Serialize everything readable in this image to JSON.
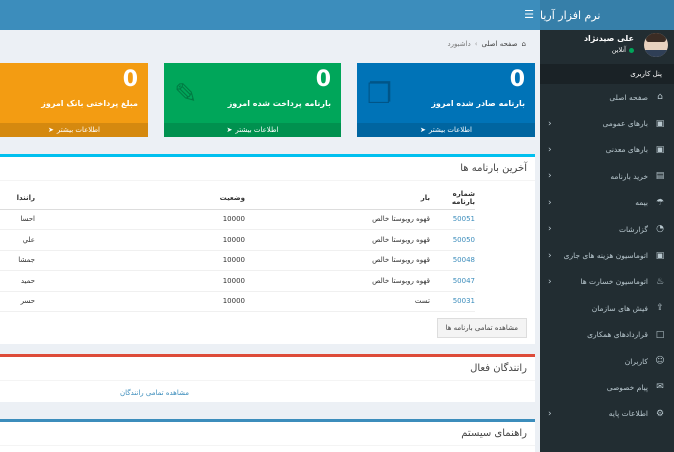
{
  "app": {
    "title": "نرم افزار آریا"
  },
  "user": {
    "name": "علی صیدنژاد",
    "status": "آنلاین"
  },
  "sidebar": {
    "header": "پنل کاربری",
    "items": [
      {
        "label": "صفحه اصلی",
        "icon": "home-icon",
        "has_children": false
      },
      {
        "label": "بارهای عمومی",
        "icon": "truck-icon",
        "has_children": true
      },
      {
        "label": "بارهای معدنی",
        "icon": "truck-icon",
        "has_children": true
      },
      {
        "label": "خرید بارنامه",
        "icon": "cart-icon",
        "has_children": true
      },
      {
        "label": "بیمه",
        "icon": "umbrella-icon",
        "has_children": true
      },
      {
        "label": "گزارشات",
        "icon": "pie-chart-icon",
        "has_children": true
      },
      {
        "label": "اتوماسیون هزینه های جاری",
        "icon": "truck-icon",
        "has_children": true
      },
      {
        "label": "اتوماسیون خسارت ها",
        "icon": "fire-icon",
        "has_children": true
      },
      {
        "label": "فیش های سازمان",
        "icon": "upload-icon",
        "has_children": false
      },
      {
        "label": "قراردادهای همکاری",
        "icon": "file-icon",
        "has_children": false
      },
      {
        "label": "کاربران",
        "icon": "users-icon",
        "has_children": false
      },
      {
        "label": "پیام خصوصی",
        "icon": "envelope-icon",
        "has_children": false
      },
      {
        "label": "اطلاعات پایه",
        "icon": "cogs-icon",
        "has_children": true
      }
    ]
  },
  "breadcrumb": {
    "home": "صفحه اصلی",
    "current": "داشبورد"
  },
  "stats": [
    {
      "value": "0",
      "label": "بارنامه صادر شده امروز",
      "more": "اطلاعات بیشتر",
      "color": "#0073b7"
    },
    {
      "value": "0",
      "label": "بارنامه پرداخت شده امروز",
      "more": "اطلاعات بیشتر",
      "color": "#00a65a"
    },
    {
      "value": "0",
      "label": "مبلغ پرداختی بانک امروز",
      "more": "اطلاعات بیشتر",
      "color": "#f39c12"
    }
  ],
  "latest": {
    "title": "آخرین بارنامه ها",
    "columns": [
      "شماره بارنامه",
      "بار",
      "وضعیت",
      "رانندا"
    ],
    "rows": [
      {
        "number": "50051",
        "load": "قهوه روبوستا خالص",
        "status": "10000",
        "driver": "احسا"
      },
      {
        "number": "50050",
        "load": "قهوه روبوستا خالص",
        "status": "10000",
        "driver": "علي"
      },
      {
        "number": "50048",
        "load": "قهوه روبوستا خالص",
        "status": "10000",
        "driver": "جمشا"
      },
      {
        "number": "50047",
        "load": "قهوه روبوستا خالص",
        "status": "10000",
        "driver": "حميد"
      },
      {
        "number": "50031",
        "load": "تست",
        "status": "10000",
        "driver": "حسر"
      }
    ],
    "view_all": "مشاهده تمامی بارنامه ها"
  },
  "drivers": {
    "title": "رانندگان فعال",
    "view_all": "مشاهده تمامی رانندگان"
  },
  "guide": {
    "title": "راهنمای سیستم"
  }
}
